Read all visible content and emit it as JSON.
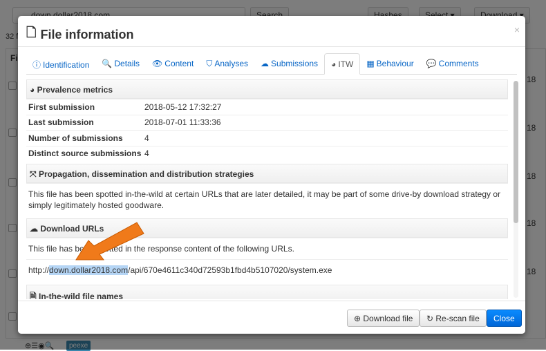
{
  "background": {
    "search_value": "down.dollar2018.com",
    "search_button": "Search",
    "hashes_button": "Hashes",
    "select_button": "Select ▾",
    "download_button": "Download ▾",
    "count_text": "32 f",
    "column_fragment": "Fi",
    "row_fragment": "18",
    "badge": "peexe"
  },
  "modal": {
    "title": "File information",
    "close": "×",
    "tabs": [
      {
        "label": "Identification",
        "icon": "ⓘ"
      },
      {
        "label": "Details",
        "icon": "🔍"
      },
      {
        "label": "Content",
        "icon": "👁"
      },
      {
        "label": "Analyses",
        "icon": "⛉"
      },
      {
        "label": "Submissions",
        "icon": "☁"
      },
      {
        "label": "ITW",
        "icon": "◕",
        "active": true
      },
      {
        "label": "Behaviour",
        "icon": "▦"
      },
      {
        "label": "Comments",
        "icon": "💬"
      }
    ],
    "prevalence": {
      "title": "Prevalence metrics",
      "rows": [
        {
          "k": "First submission",
          "v": "2018-05-12 17:32:27"
        },
        {
          "k": "Last submission",
          "v": "2018-07-01 11:33:36"
        },
        {
          "k": "Number of submissions",
          "v": "4"
        },
        {
          "k": "Distinct source submissions",
          "v": "4"
        }
      ]
    },
    "propagation": {
      "title": "Propagation, dissemination and distribution strategies",
      "text": "This file has been spotted in-the-wild at certain URLs that are later detailed, it may be part of some drive-by download strategy or simply legitimately hosted goodware."
    },
    "download_urls": {
      "title": "Download URLs",
      "text": "This file has been spotted in the response content of the following URLs.",
      "url_prefix": "http://",
      "url_host": "down.dollar2018.com",
      "url_path": "/api/670e4611c340d72593b1fbd4b5107020/system.exe"
    },
    "itw_names": {
      "title": "In-the-wild file names"
    },
    "footer": {
      "download": "Download file",
      "rescan": "Re-scan file",
      "close": "Close"
    }
  },
  "colors": {
    "accent": "#0866c6",
    "primary_button": "#0a7cf0",
    "arrow": "#f07a1a"
  }
}
